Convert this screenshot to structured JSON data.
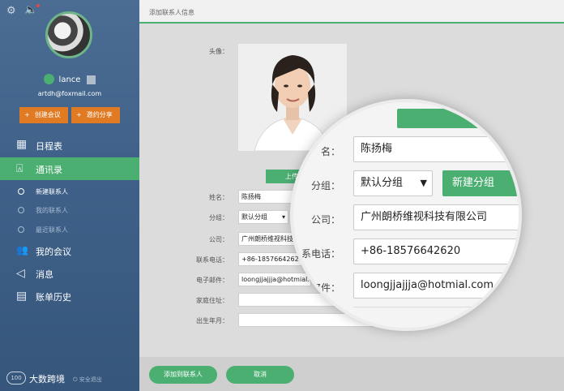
{
  "sidebar": {
    "user_name": "lance",
    "email": "artdh@foxmail.com",
    "create_meeting": "创建会议",
    "invite_share": "邀约分享",
    "menu": [
      {
        "label": "日程表",
        "icon": "calendar-icon",
        "glyph": "▦"
      },
      {
        "label": "通讯录",
        "icon": "contacts-icon",
        "glyph": "⍓"
      },
      {
        "label": "我的会议",
        "icon": "people-icon",
        "glyph": "👥"
      },
      {
        "label": "消息",
        "icon": "speaker-icon",
        "glyph": "◁"
      },
      {
        "label": "账单历史",
        "icon": "bill-icon",
        "glyph": "▤"
      }
    ],
    "submenu": [
      "新建联系人",
      "我的联系人",
      "最近联系人"
    ],
    "brand": "大数跨境",
    "logout": "安全退出"
  },
  "main": {
    "title": "添加联系人信息",
    "avatar_label": "头像：",
    "upload_btn": "上传",
    "fields": {
      "name": {
        "label": "姓名：",
        "value": "陈扬梅"
      },
      "group": {
        "label": "分组：",
        "value": "默认分组",
        "new_group": "新建分组"
      },
      "company": {
        "label": "公司：",
        "value": "广州朗桥维视科技有限公司"
      },
      "phone": {
        "label": "联系电话：",
        "value": "+86-18576642620"
      },
      "email": {
        "label": "电子邮件：",
        "value": "loongjjajjja@hotmial.com"
      },
      "address": {
        "label": "家庭住址：",
        "value": ""
      },
      "birth": {
        "label": "出生年月：",
        "value": ""
      }
    },
    "add_btn": "添加到联系人",
    "cancel_btn": "取消"
  },
  "magnifier": {
    "name_label": "名：",
    "name_value": "陈扬梅",
    "group_label": "分组：",
    "group_value": "默认分组",
    "new_group": "新建分组",
    "company_label": "公司：",
    "company_value": "广州朗桥维视科技有限公司",
    "phone_label": "系电话：",
    "phone_value": "+86-18576642620",
    "email_label": "7件：",
    "email_value": "loongjjajjja@hotmial.com"
  },
  "colors": {
    "accent": "#4caf72",
    "orange": "#e07b24",
    "sidebar": "#3f6189"
  }
}
